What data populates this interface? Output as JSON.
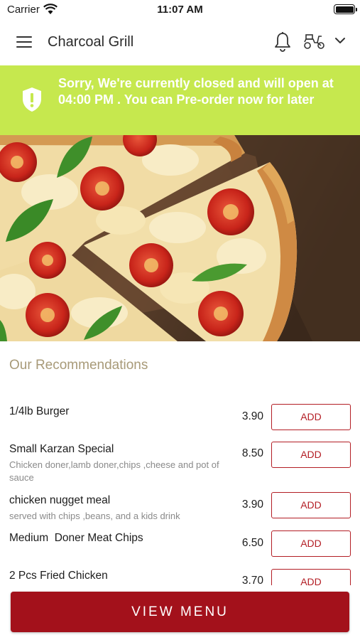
{
  "status_bar": {
    "carrier": "Carrier",
    "time": "11:07 AM"
  },
  "header": {
    "title": "Charcoal Grill",
    "icons": [
      "menu-icon",
      "bell-icon",
      "scooter-icon",
      "chevron-down-icon"
    ]
  },
  "banner": {
    "text": "Sorry, We're currently closed and will open at 04:00 PM . You can Pre-order now for later",
    "icon": "shield-alert-icon",
    "background": "#c6e84e"
  },
  "recommendations": {
    "title": "Our Recommendations",
    "items": [
      {
        "name": "1/4lb Burger",
        "description": "",
        "price": "3.90",
        "button": "ADD"
      },
      {
        "name": "Small Karzan Special",
        "description": "Chicken doner,lamb doner,chips ,cheese and pot of sauce",
        "price": "8.50",
        "button": "ADD"
      },
      {
        "name": "chicken nugget meal",
        "description": "served with chips ,beans, and a kids drink",
        "price": "3.90",
        "button": "ADD"
      },
      {
        "name": "Medium  Doner Meat Chips",
        "description": "",
        "price": "6.50",
        "button": "ADD"
      },
      {
        "name": "2 Pcs Fried Chicken",
        "description": "",
        "price": "3.70",
        "button": "ADD"
      }
    ]
  },
  "footer": {
    "view_menu_label": "VIEW MENU"
  },
  "colors": {
    "accent": "#a3111b",
    "banner": "#c6e84e",
    "section_title": "#a89a78"
  }
}
